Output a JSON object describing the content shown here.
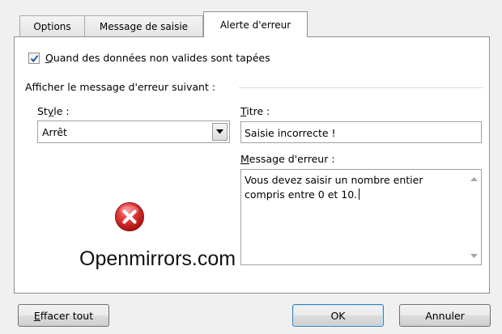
{
  "tabs": [
    {
      "label": "Options",
      "active": false
    },
    {
      "label": "Message de saisie",
      "active": false
    },
    {
      "label": "Alerte d'erreur",
      "active": true
    }
  ],
  "checkbox": {
    "checked": true,
    "label_accel": "Q",
    "label_rest": "uand des données non valides sont tapées"
  },
  "group_label": "Afficher le message d'erreur suivant :",
  "style": {
    "label_pre": "St",
    "label_accel": "y",
    "label_post": "le :",
    "selected": "Arrêt"
  },
  "titre": {
    "label_accel": "T",
    "label_rest": "itre :",
    "value": "Saisie incorrecte !"
  },
  "message": {
    "label_accel": "M",
    "label_rest": "essage d'erreur :",
    "value": "Vous devez saisir un nombre entier\ncompris entre 0 et 10."
  },
  "icons": {
    "error": "error-stop-icon",
    "dropdown": "chevron-down-icon",
    "scroll_up": "scroll-up-arrow-icon",
    "scroll_down": "scroll-down-arrow-icon"
  },
  "watermark": "Openmirrors.com",
  "buttons": {
    "clear_accel": "E",
    "clear_rest": "ffacer tout",
    "ok": "OK",
    "cancel": "Annuler"
  },
  "colors": {
    "error_red": "#d42020",
    "check_blue": "#1b4f9c",
    "ok_border": "#3c7fb1"
  }
}
